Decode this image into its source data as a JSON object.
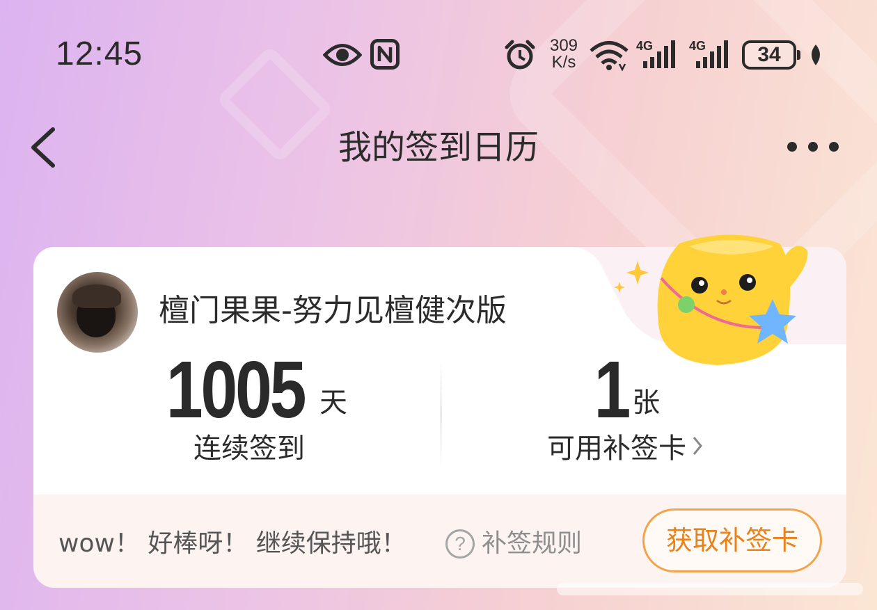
{
  "status_bar": {
    "time": "12:45",
    "net_speed_value": "309",
    "net_speed_unit": "K/s",
    "network_1": "4G",
    "network_2": "4G",
    "battery": "34",
    "icons": [
      "eye-icon",
      "nfc-icon",
      "alarm-icon",
      "wifi-icon",
      "signal-icon",
      "battery-icon",
      "leaf-icon"
    ]
  },
  "nav": {
    "title": "我的签到日历"
  },
  "card": {
    "username": "檀门果果-努力见檀健次版",
    "streak": {
      "value": "1005",
      "unit": "天",
      "label": "连续签到"
    },
    "makeup_cards": {
      "value": "1",
      "unit": "张",
      "label": "可用补签卡"
    },
    "encourage_text": "wow！ 好棒呀！ 继续保持哦！",
    "rules_link": "补签规则",
    "get_card_button": "获取补签卡"
  },
  "colors": {
    "accent_orange": "#e8821a",
    "button_border": "#f3a44a",
    "mascot_yellow": "#ffd23a"
  }
}
